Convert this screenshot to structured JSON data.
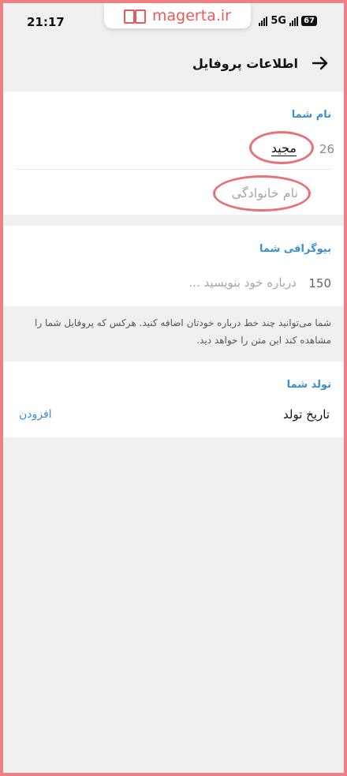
{
  "status_bar": {
    "time": "21:17",
    "network": "5G",
    "battery": "67"
  },
  "watermark": {
    "text": "magerta.ir",
    "logo_icon": "open-book-icon"
  },
  "header": {
    "title": "اطلاعات پروفایل",
    "back_icon": "arrow-right-icon"
  },
  "name_section": {
    "title": "نام شما",
    "first_name_value": "مجید",
    "first_name_counter": "26",
    "last_name_placeholder": "نام خانوادگی"
  },
  "bio_section": {
    "title": "بیوگرافی شما",
    "placeholder": "درباره خود بنویسید ...",
    "counter": "150",
    "hint": "شما می‌توانید چند خط درباره خودتان اضافه کنید. هرکس که پروفایل شما را مشاهده کند این متن را خواهد دید."
  },
  "birthday_section": {
    "title": "تولد شما",
    "label": "تاریخ تولد",
    "add_link": "افزودن"
  },
  "colors": {
    "accent": "#3a8fd0",
    "highlight": "#e67378",
    "frame": "#ee7f82"
  }
}
